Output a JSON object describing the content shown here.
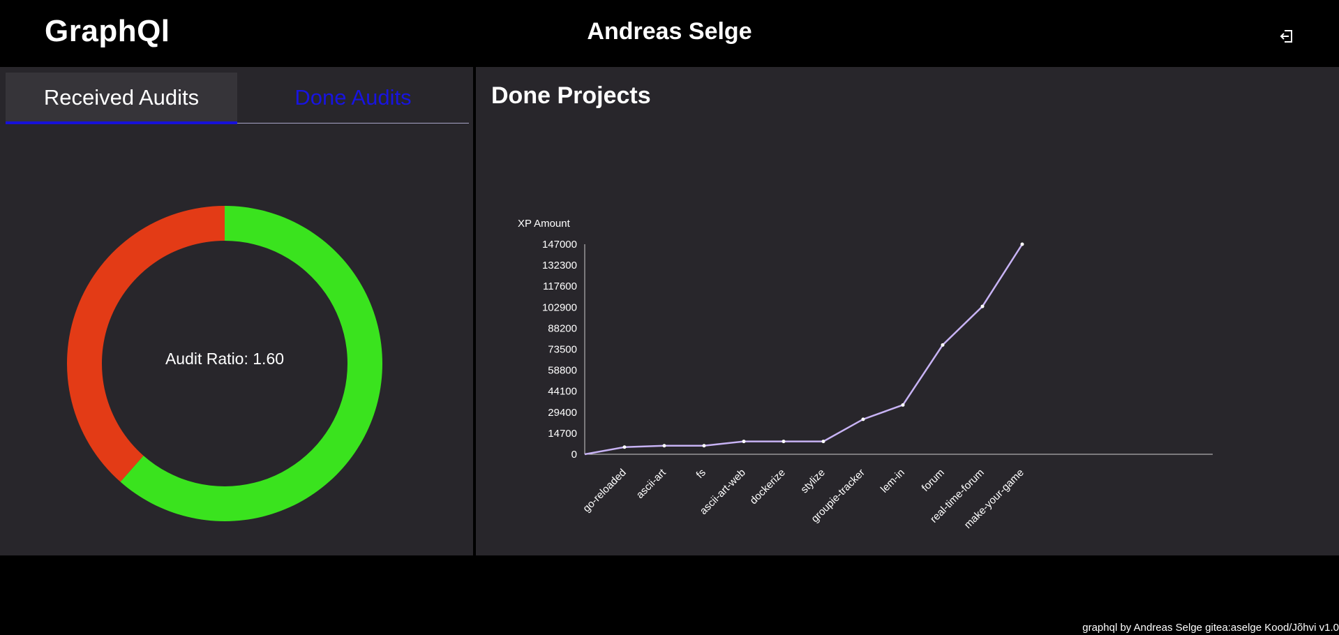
{
  "header": {
    "app_title": "GraphQl",
    "user_name": "Andreas Selge",
    "logout_icon": "logout-icon"
  },
  "audits": {
    "tabs": [
      {
        "label": "Received Audits",
        "active": true
      },
      {
        "label": "Done Audits",
        "active": false
      }
    ],
    "ratio_label": "Audit Ratio: 1.60",
    "donut": {
      "segments": [
        {
          "name": "done",
          "color": "#3ae31e",
          "fraction": 0.615
        },
        {
          "name": "received",
          "color": "#e33b16",
          "fraction": 0.385
        }
      ]
    }
  },
  "projects": {
    "title": "Done Projects"
  },
  "chart_data": {
    "type": "line",
    "title": "",
    "xlabel": "",
    "ylabel": "XP Amount",
    "ylim": [
      0,
      147000
    ],
    "yticks": [
      "0",
      "14700",
      "29400",
      "44100",
      "58800",
      "73500",
      "88200",
      "102900",
      "117600",
      "132300",
      "147000"
    ],
    "categories": [
      "go-reloaded",
      "ascii-art",
      "fs",
      "ascii-art-web",
      "dockerize",
      "stylize",
      "groupie-tracker",
      "lem-in",
      "forum",
      "real-time-forum",
      "make-your-game"
    ],
    "series": [
      {
        "values": [
          0,
          5000,
          6000,
          6000,
          9000,
          9000,
          9000,
          24500,
          34500,
          76500,
          103500,
          147000
        ],
        "color": "#c8b3f5"
      }
    ]
  },
  "footer": {
    "text": "graphql by Andreas Selge gitea:aselge Kood/Jõhvi v1.0"
  }
}
